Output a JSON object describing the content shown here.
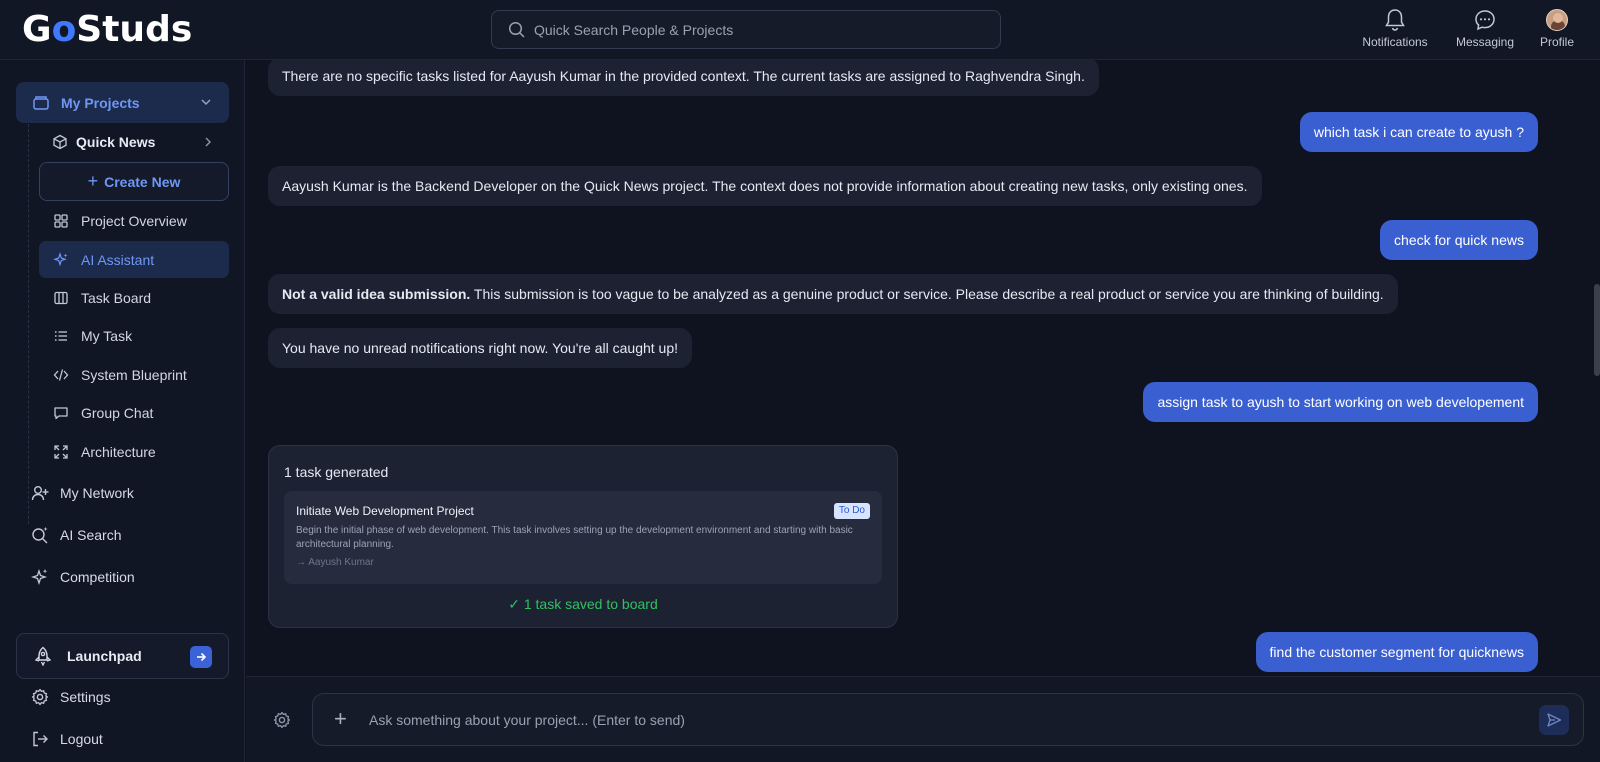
{
  "header": {
    "logo": {
      "prefix": "G",
      "accent": "o",
      "suffix": "Studs"
    },
    "search_placeholder": "Quick Search People & Projects",
    "notifications_label": "Notifications",
    "messaging_label": "Messaging",
    "profile_label": "Profile"
  },
  "sidebar": {
    "my_projects": "My Projects",
    "project_name": "Quick News",
    "create_new": "Create New",
    "project_items": [
      {
        "label": "Project Overview",
        "icon": "grid-icon"
      },
      {
        "label": "AI Assistant",
        "icon": "sparkle-icon",
        "active": true
      },
      {
        "label": "Task Board",
        "icon": "columns-icon"
      },
      {
        "label": "My Task",
        "icon": "list-icon"
      },
      {
        "label": "System Blueprint",
        "icon": "code-icon"
      },
      {
        "label": "Group Chat",
        "icon": "chat-icon"
      },
      {
        "label": "Architecture",
        "icon": "expand-icon"
      }
    ],
    "main_items": [
      {
        "label": "My Network",
        "icon": "add-user-icon"
      },
      {
        "label": "AI Search",
        "icon": "search-sparkle-icon"
      },
      {
        "label": "Competition",
        "icon": "sparkles-icon"
      }
    ],
    "launchpad": "Launchpad",
    "settings": "Settings",
    "logout": "Logout"
  },
  "chat": {
    "messages": [
      {
        "role": "assistant",
        "text": "There are no specific tasks listed for Aayush Kumar in the provided context. The current tasks are assigned to Raghvendra Singh."
      },
      {
        "role": "user",
        "text": "which task i can create to ayush ?"
      },
      {
        "role": "assistant",
        "text": "Aayush Kumar is the Backend Developer on the Quick News project. The context does not provide information about creating new tasks, only existing ones."
      },
      {
        "role": "user",
        "text": "check for quick news"
      },
      {
        "role": "assistant",
        "bold": "Not a valid idea submission.",
        "text": " This submission is too vague to be analyzed as a genuine product or service. Please describe a real product or service you are thinking of building."
      },
      {
        "role": "assistant",
        "text": "You have no unread notifications right now. You're all caught up!"
      },
      {
        "role": "user",
        "text": "assign task to ayush to start working on web developement"
      },
      {
        "role": "user",
        "text": "find the customer segment for quicknews"
      }
    ],
    "task_card": {
      "count_label": "1 task generated",
      "task": {
        "title": "Initiate Web Development Project",
        "status": "To Do",
        "description": "Begin the initial phase of web development. This task involves setting up the development environment and starting with basic architectural planning.",
        "assignee": "→ Aayush Kumar"
      },
      "saved_label": "✓ 1 task saved to board"
    }
  },
  "composer": {
    "placeholder": "Ask something about your project... (Enter to send)"
  },
  "colors": {
    "accent": "#3f79ff",
    "user_bubble": "#3a5fd1",
    "active_bg": "#1c2a4c",
    "success": "#2fc15f"
  }
}
